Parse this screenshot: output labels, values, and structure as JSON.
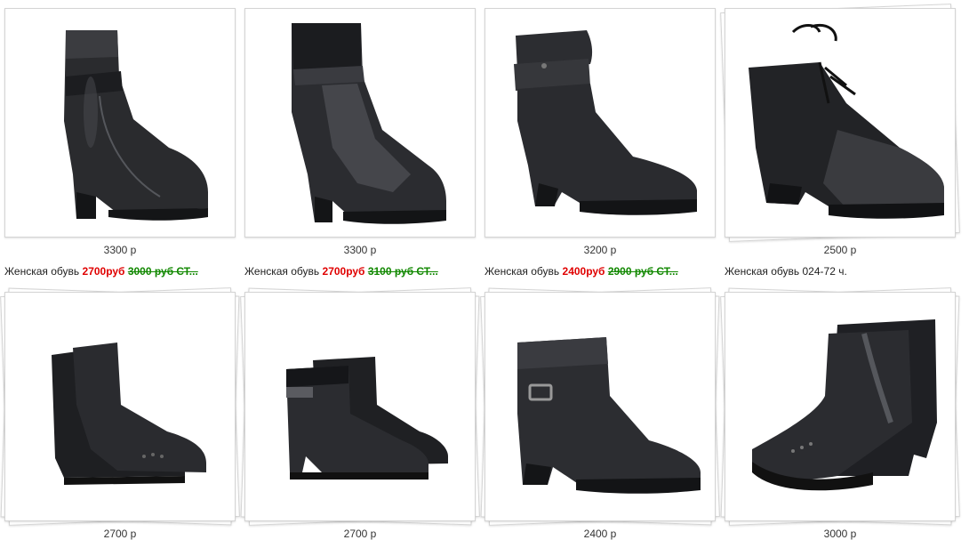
{
  "colors": {
    "sale": "#e00000",
    "old": "#118800",
    "border": "#d4d4d4"
  },
  "products": [
    {
      "image": "black-leather-ankle-boot-with-strap",
      "price": "3300 р",
      "title_prefix": "Женская обувь",
      "sale_price": "2700руб",
      "old_price": "3000 руб СТ...",
      "title_rest": ""
    },
    {
      "image": "black-suede-leather-ankle-boot",
      "price": "3300 р",
      "title_prefix": "Женская обувь",
      "sale_price": "2700руб",
      "old_price": "3100 руб СТ...",
      "title_rest": ""
    },
    {
      "image": "black-slouch-leather-ankle-boot",
      "price": "3200 р",
      "title_prefix": "Женская обувь",
      "sale_price": "2400руб",
      "old_price": "2900 руб СТ...",
      "title_rest": ""
    },
    {
      "image": "black-lace-up-snakeskin-boot",
      "price": "2500 р",
      "title_prefix": "Женская обувь 024-72 ч.",
      "sale_price": "",
      "old_price": "",
      "title_rest": ""
    },
    {
      "image": "black-suede-boot-pair-brogue",
      "price": "2700 р",
      "title_prefix": "",
      "sale_price": "",
      "old_price": "",
      "title_rest": ""
    },
    {
      "image": "black-boot-pair-with-buckle",
      "price": "2700 р",
      "title_prefix": "",
      "sale_price": "",
      "old_price": "",
      "title_rest": ""
    },
    {
      "image": "black-leather-boot-with-buckle",
      "price": "2400 р",
      "title_prefix": "",
      "sale_price": "",
      "old_price": "",
      "title_rest": ""
    },
    {
      "image": "black-studded-chelsea-boot-pair",
      "price": "3000 р",
      "title_prefix": "",
      "sale_price": "",
      "old_price": "",
      "title_rest": ""
    }
  ]
}
